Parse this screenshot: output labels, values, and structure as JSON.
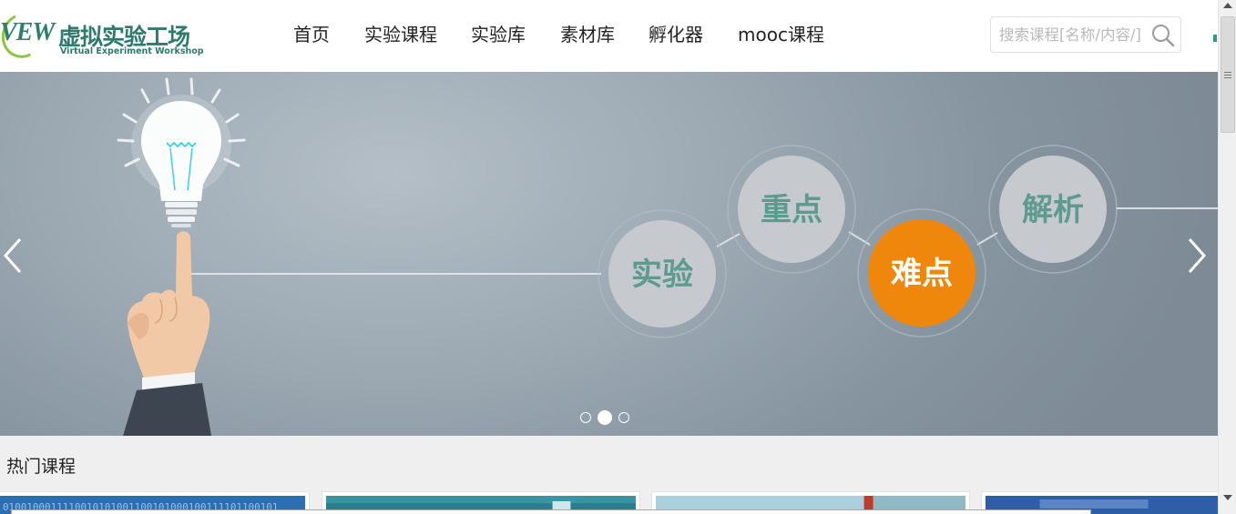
{
  "header": {
    "logo": {
      "mark": "VEW",
      "name_cn": "虚拟实验工场",
      "name_en": "Virtual Experiment Workshop"
    },
    "nav": [
      {
        "label": "首页"
      },
      {
        "label": "实验课程"
      },
      {
        "label": "实验库"
      },
      {
        "label": "素材库"
      },
      {
        "label": "孵化器"
      },
      {
        "label": "mooc课程"
      }
    ],
    "search": {
      "placeholder": "搜索课程[名称/内容/]",
      "value": "",
      "icon": "search-icon"
    }
  },
  "banner": {
    "slide_count": 3,
    "active_slide": 2,
    "bubbles": [
      {
        "label": "实验",
        "highlight": false
      },
      {
        "label": "重点",
        "highlight": false
      },
      {
        "label": "难点",
        "highlight": true
      },
      {
        "label": "解析",
        "highlight": false
      }
    ],
    "colors": {
      "bubble": "#c6c9ce",
      "bubble_text": "#5d9b8f",
      "highlight": "#ee870b",
      "highlight_text": "#ffffff"
    },
    "prev_icon": "chevron-left-icon",
    "next_icon": "chevron-right-icon"
  },
  "hot_courses": {
    "title": "热门课程",
    "items": [
      {
        "thumb": "blue-binary-code-image"
      },
      {
        "thumb": "teal-tech-image"
      },
      {
        "thumb": "light-tech-image"
      },
      {
        "thumb": "blue-circuit-image"
      }
    ]
  },
  "colors": {
    "brand": "#2e7a6c",
    "brand_accent": "#8cc63f",
    "page_bg": "#efefef"
  }
}
